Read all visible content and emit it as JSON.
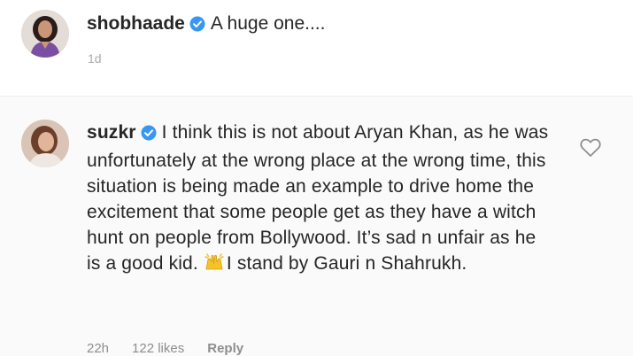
{
  "post": {
    "username": "shobhaade",
    "text": "A huge one....",
    "time": "1d"
  },
  "comment": {
    "username": "suzkr",
    "text_before_emoji": "I think this is not about Aryan Khan, as he was unfortunately at the wrong place at the wrong time, this situation is being made an example to drive home the excitement that some people get as they have a witch hunt on people from Bollywood. It’s sad n unfair as he is a good kid.",
    "text_after_emoji": "I stand by Gauri n Shahrukh.",
    "emoji": "raising-hands-icon",
    "time": "22h",
    "likes": "122 likes",
    "reply_label": "Reply"
  },
  "colors": {
    "verified_badge": "#3897f0",
    "secondary_text": "#8e8e8e",
    "primary_text": "#262626"
  }
}
